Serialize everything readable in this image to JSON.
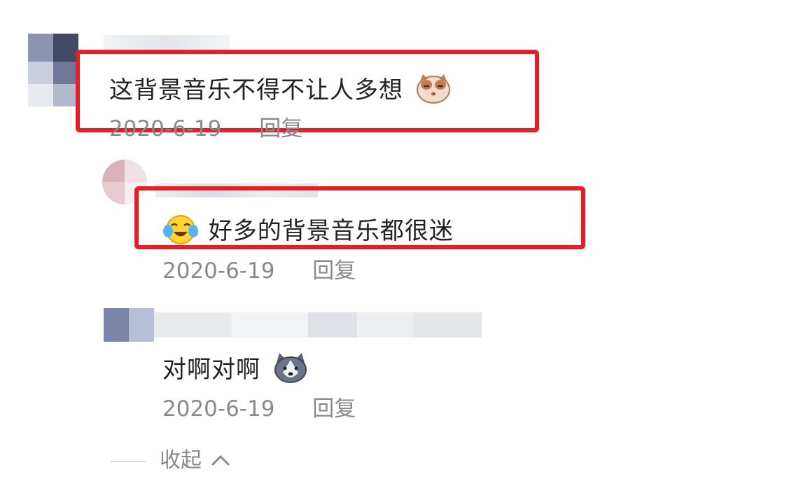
{
  "comments": [
    {
      "text": "这背景音乐不得不让人多想",
      "emoji": "cat-face-emoji",
      "date": "2020-6-19",
      "reply_label": "回复",
      "highlighted": true
    },
    {
      "text": "好多的背景音乐都很迷",
      "emoji": "crying-laughing-face-emoji",
      "date": "2020-6-19",
      "reply_label": "回复",
      "highlighted": true
    },
    {
      "text": "对啊对啊",
      "emoji": "husky-dog-face-emoji",
      "date": "2020-6-19",
      "reply_label": "回复",
      "highlighted": false
    }
  ],
  "collapse": {
    "label": "收起",
    "icon": "chevron-up-icon"
  },
  "colors": {
    "highlight": "#ec1c24",
    "text": "#222222",
    "meta": "#8a8a8a"
  }
}
